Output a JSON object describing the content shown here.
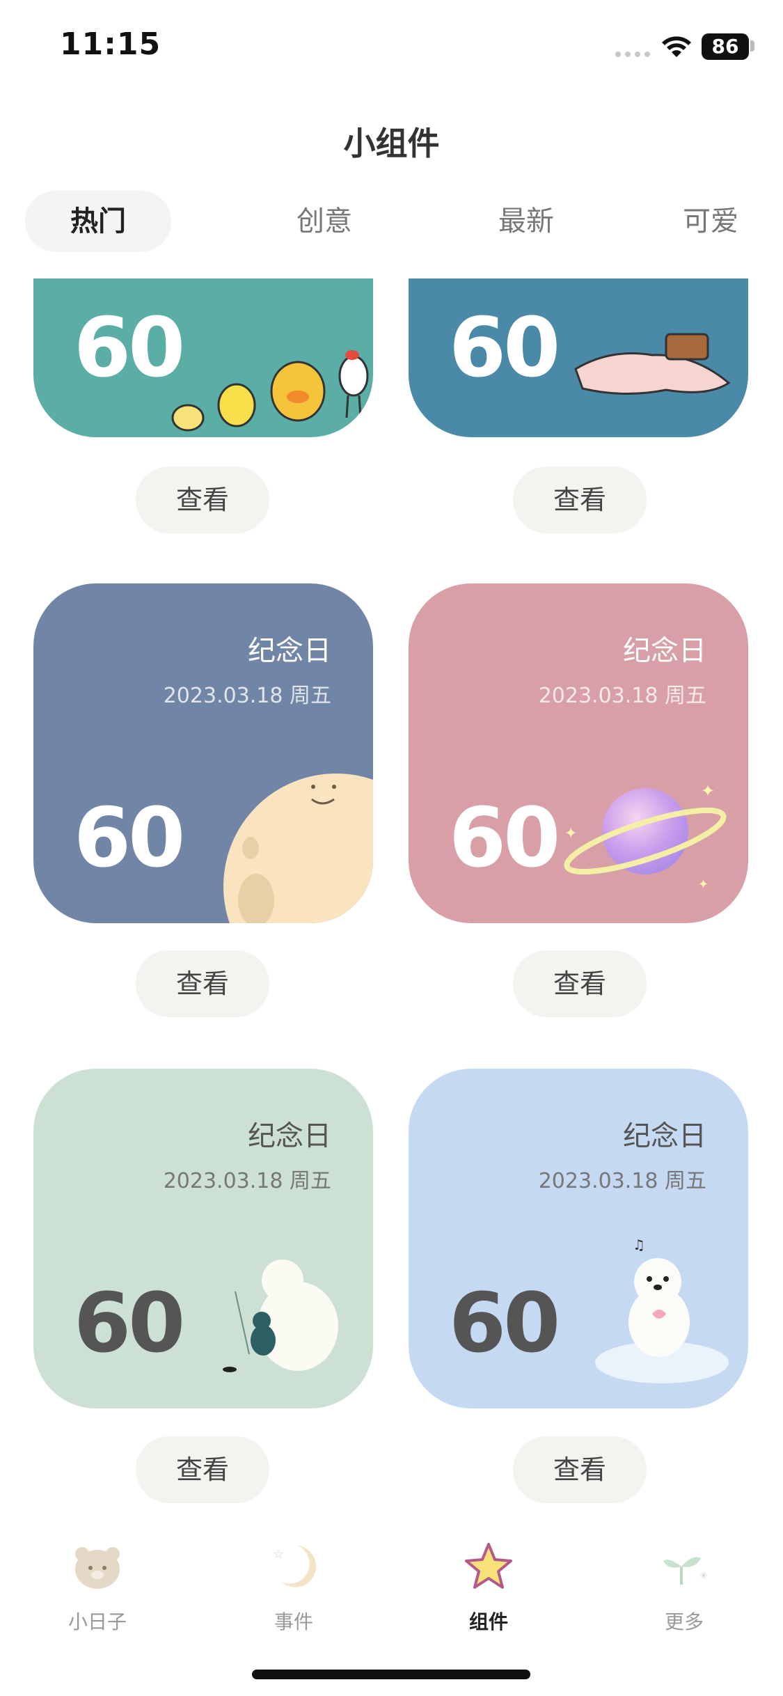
{
  "status": {
    "time": "11:15",
    "battery": "86"
  },
  "header": {
    "title": "小组件"
  },
  "tabs": [
    {
      "label": "热门",
      "active": true
    },
    {
      "label": "创意",
      "active": false
    },
    {
      "label": "最新",
      "active": false
    },
    {
      "label": "可爱",
      "active": false
    }
  ],
  "cards": [
    {
      "count": "60",
      "color": "#5aaea5",
      "art": "chicks-illustration"
    },
    {
      "count": "60",
      "color": "#4b89a8",
      "art": "sleeping-figure-illustration"
    },
    {
      "label": "纪念日",
      "date": "2023.03.18 周五",
      "count": "60",
      "color": "#7186a6",
      "art": "moon-face-illustration"
    },
    {
      "label": "纪念日",
      "date": "2023.03.18 周五",
      "count": "60",
      "color": "#d8a0a6",
      "art": "planet-illustration"
    },
    {
      "label": "纪念日",
      "date": "2023.03.18 周五",
      "count": "60",
      "color": "#cde0d4",
      "art": "bear-fishing-illustration"
    },
    {
      "label": "纪念日",
      "date": "2023.03.18 周五",
      "count": "60",
      "color": "#c6d9f3",
      "art": "bear-on-ice-illustration"
    }
  ],
  "view_button_label": "查看",
  "bottom_nav": [
    {
      "label": "小日子",
      "icon": "bear-icon",
      "active": false
    },
    {
      "label": "事件",
      "icon": "moon-icon",
      "active": false
    },
    {
      "label": "组件",
      "icon": "star-icon",
      "active": true
    },
    {
      "label": "更多",
      "icon": "sprout-icon",
      "active": false
    }
  ]
}
